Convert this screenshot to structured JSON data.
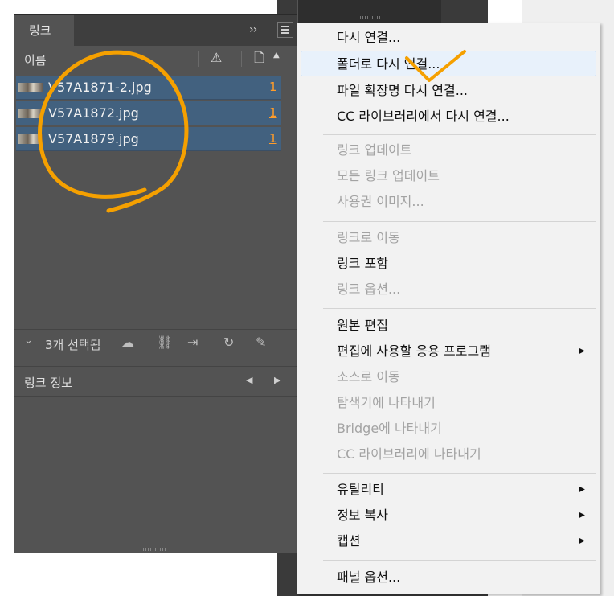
{
  "panel": {
    "tab_label": "링크",
    "collapse_glyph": "››",
    "column_name": "이름",
    "column_warning_glyph": "⚠",
    "column_page_glyph": "🗋",
    "sort_glyph": "▲",
    "files": [
      {
        "name": "V57A1871-2.jpg",
        "page": "1"
      },
      {
        "name": "V57A1872.jpg",
        "page": "1"
      },
      {
        "name": "V57A1879.jpg",
        "page": "1"
      }
    ],
    "selection_count": "3개 선택됨",
    "info_title": "링크 정보",
    "prev_glyph": "◀",
    "next_glyph": "▶"
  },
  "menu": {
    "submenu_glyph": "▶",
    "items": [
      {
        "label": "다시 연결...",
        "enabled": true
      },
      {
        "label": "폴더로 다시 연결...",
        "enabled": true,
        "highlighted": true
      },
      {
        "label": "파일 확장명 다시 연결...",
        "enabled": true
      },
      {
        "label": "CC 라이브러리에서 다시 연결...",
        "enabled": true
      },
      {
        "label": "링크 업데이트",
        "enabled": false
      },
      {
        "label": "모든 링크 업데이트",
        "enabled": false
      },
      {
        "label": "사용권 이미지...",
        "enabled": false
      },
      {
        "label": "링크로 이동",
        "enabled": false
      },
      {
        "label": "링크 포함",
        "enabled": true
      },
      {
        "label": "링크 옵션...",
        "enabled": false
      },
      {
        "label": "원본 편집",
        "enabled": true
      },
      {
        "label": "편집에 사용할 응용 프로그램",
        "enabled": true,
        "submenu": true
      },
      {
        "label": "소스로 이동",
        "enabled": false
      },
      {
        "label": "탐색기에 나타내기",
        "enabled": false
      },
      {
        "label": "Bridge에 나타내기",
        "enabled": false
      },
      {
        "label": "CC 라이브러리에 나타내기",
        "enabled": false
      },
      {
        "label": "유틸리티",
        "enabled": true,
        "submenu": true
      },
      {
        "label": "정보 복사",
        "enabled": true,
        "submenu": true
      },
      {
        "label": "캡션",
        "enabled": true,
        "submenu": true
      },
      {
        "label": "패널 옵션...",
        "enabled": true
      }
    ]
  },
  "colors": {
    "panel_bg": "#535353",
    "selected_row": "#42617f",
    "page_link": "#ff9c2a",
    "annotation": "#f5a000",
    "menu_bg": "#f2f2f2",
    "menu_disabled": "#a3a3a3"
  }
}
